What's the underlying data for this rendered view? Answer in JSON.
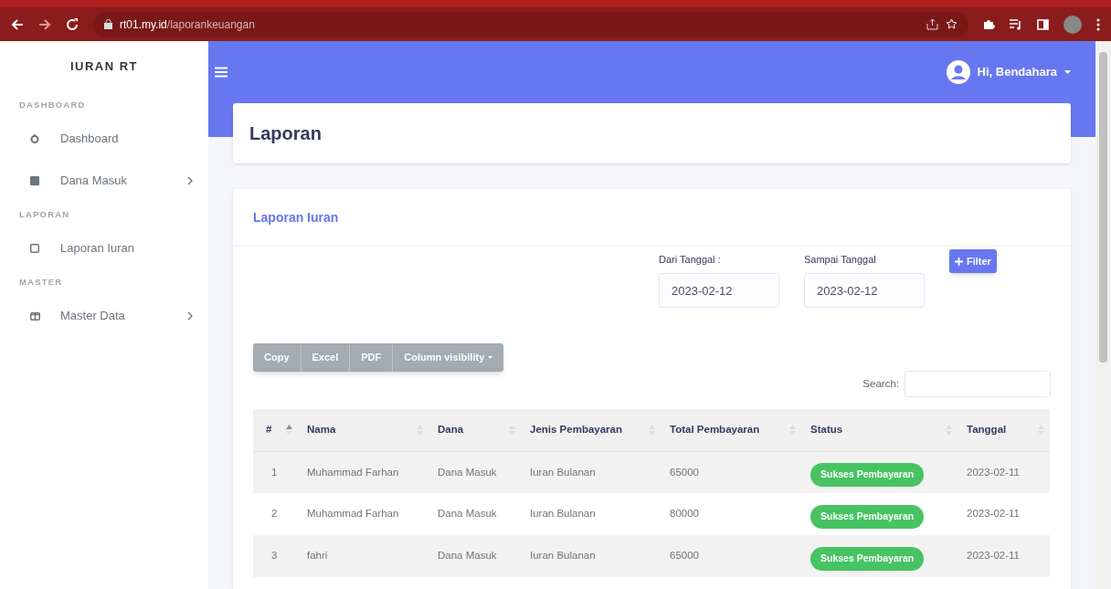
{
  "browser": {
    "url": "**rt01.my.id**/laporankeuangan"
  },
  "sidebar": {
    "brand": "IURAN RT",
    "sections": [
      {
        "heading": "DASHBOARD",
        "items": [
          {
            "label": "Dashboard",
            "kind": "gauge",
            "expandable": false
          },
          {
            "label": "Dana Masuk",
            "kind": "square",
            "expandable": true
          }
        ]
      },
      {
        "heading": "LAPORAN",
        "items": [
          {
            "label": "Laporan Iuran",
            "kind": "outline",
            "expandable": false
          }
        ]
      },
      {
        "heading": "MASTER",
        "items": [
          {
            "label": "Master Data",
            "kind": "columns",
            "expandable": true
          }
        ]
      }
    ]
  },
  "topbar": {
    "user": "Hi, Bendahara"
  },
  "page_title": "Laporan",
  "card": {
    "title": "Laporan Iuran",
    "filters": [
      {
        "label": "Dari Tanggal :",
        "value": "2023-02-12"
      },
      {
        "label": "Sampai Tanggal",
        "value": "2023-02-12"
      }
    ],
    "filter_button": "Filter",
    "export_buttons": [
      "Copy",
      "Excel",
      "PDF",
      "Column visibility"
    ],
    "search_label": "Search:",
    "table": {
      "columns": [
        {
          "label": "#",
          "sorted": true
        },
        {
          "label": "Nama",
          "sorted": false
        },
        {
          "label": "Dana",
          "sorted": false
        },
        {
          "label": "Jenis Pembayaran",
          "sorted": false
        },
        {
          "label": "Total Pembayaran",
          "sorted": false
        },
        {
          "label": "Status",
          "sorted": false
        },
        {
          "label": "Tanggal",
          "sorted": false
        }
      ],
      "rows": [
        [
          "1",
          "Muhammad Farhan",
          "Dana Masuk",
          "Iuran Bulanan",
          "65000",
          "Sukses Pembayaran",
          "2023-02-11"
        ],
        [
          "2",
          "Muhammad Farhan",
          "Dana Masuk",
          "Iuran Bulanan",
          "80000",
          "Sukses Pembayaran",
          "2023-02-11"
        ],
        [
          "3",
          "fahri",
          "Dana Masuk",
          "Iuran Bulanan",
          "65000",
          "Sukses Pembayaran",
          "2023-02-11"
        ]
      ]
    }
  }
}
